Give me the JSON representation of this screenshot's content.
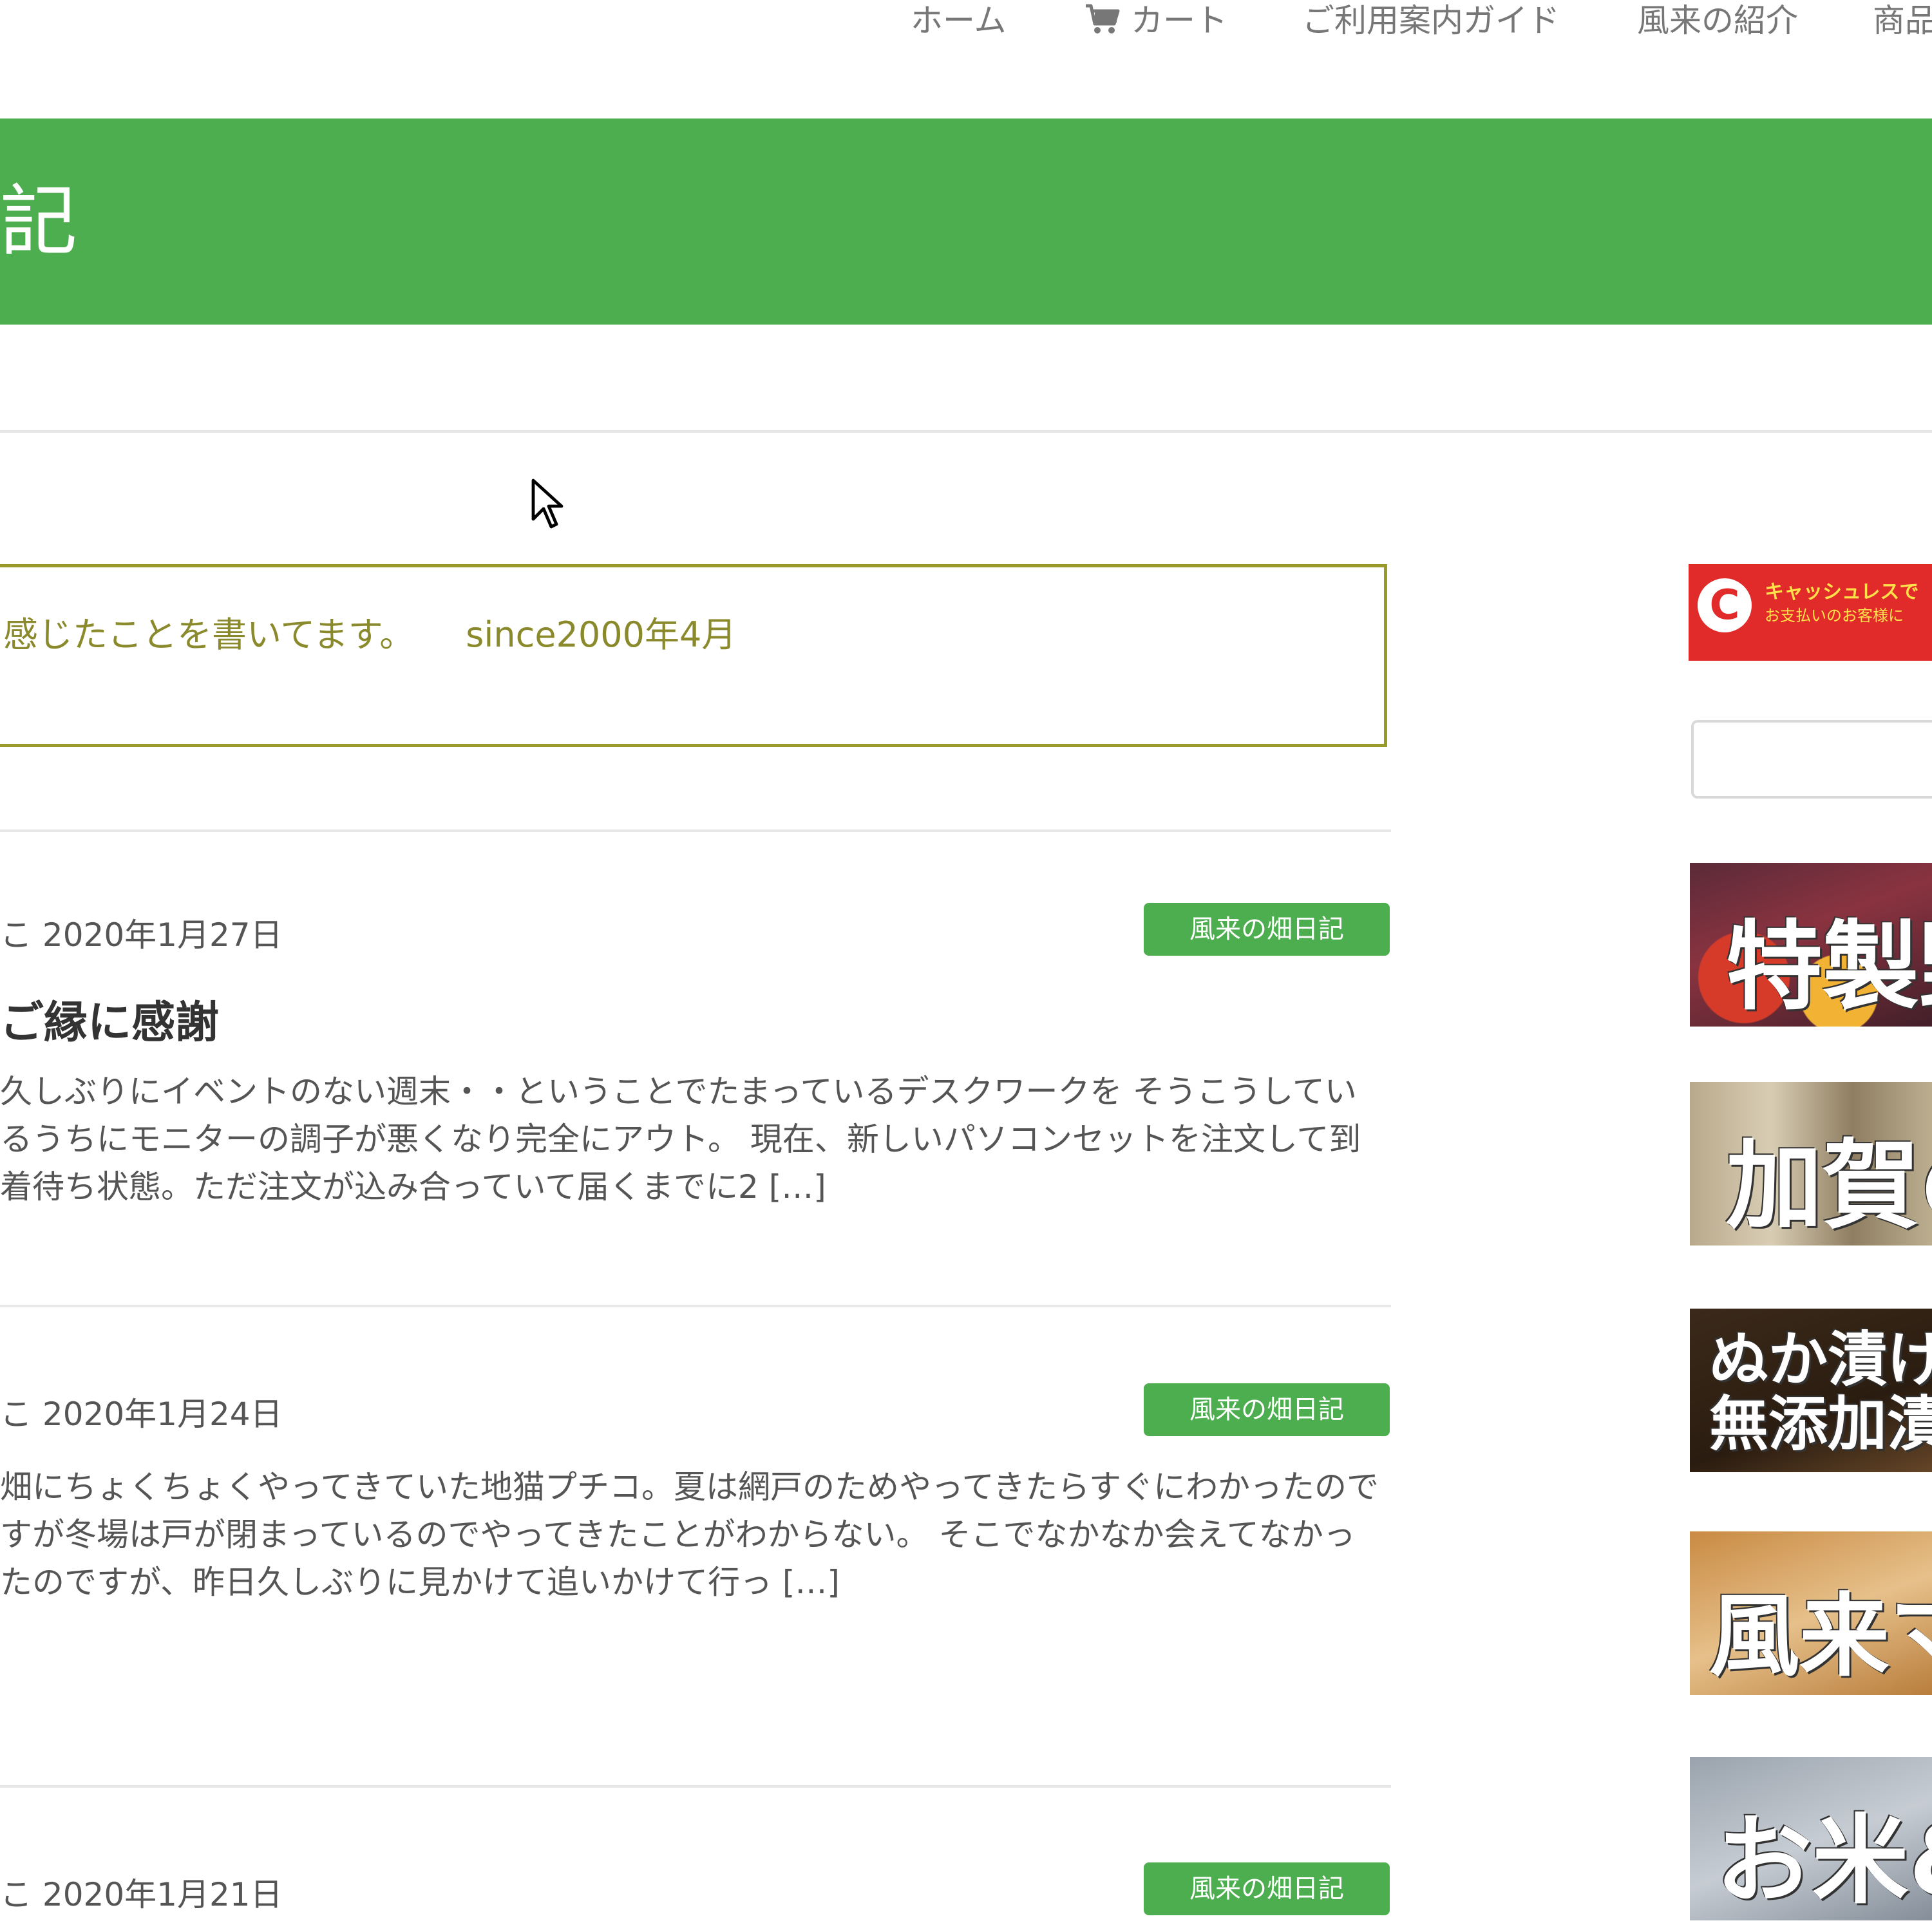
{
  "nav": {
    "home": "ホーム",
    "cart": "カート",
    "guide": "ご利用案内ガイド",
    "about": "風来の紹介",
    "products": "商品"
  },
  "banner": {
    "title": "記",
    "color": "#4cae4f"
  },
  "description": {
    "text": "感じたことを書いてます。",
    "since": "since2000年4月"
  },
  "posts": [
    {
      "meta": "こ 2020年1月27日",
      "category": "風来の畑日記",
      "title": "ご縁に感謝",
      "excerpt": "久しぶりにイベントのない週末・・ということでたまっているデスクワークを そうこうしているうちにモニターの調子が悪くなり完全にアウト。 現在、新しいパソコンセットを注文して到着待ち状態。ただ注文が込み合っていて届くまでに2 […]"
    },
    {
      "meta": "こ 2020年1月24日",
      "category": "風来の畑日記",
      "title": "",
      "excerpt": "畑にちょくちょくやってきていた地猫プチコ。夏は網戸のためやってきたらすぐにわかったのですが冬場は戸が閉まっているのでやってきたことがわからない。 そこでなかなか会えてなかったのですが、昨日久しぶりに見かけて追いかけて行っ […]"
    },
    {
      "meta": "こ 2020年1月21日",
      "category": "風来の畑日記"
    }
  ],
  "sidebar": {
    "ad": {
      "logo": "C",
      "line1": "キャッシュレスで",
      "line2": "お支払いのお客様に"
    },
    "search": {
      "value": "",
      "placeholder": ""
    },
    "banners": {
      "b1": "特製野",
      "b2": "加賀の野",
      "b3_line1": "ぬか漬け",
      "b3_line2": "無添加漬物",
      "b4": "風来ママの",
      "b5": "お米&"
    }
  },
  "colors": {
    "accent": "#4cae4f",
    "desc_border": "#9a9a2a",
    "ad_red": "#e12a2a"
  },
  "icons": {
    "cart": "cart-icon",
    "cursor": "mouse-pointer-icon"
  }
}
